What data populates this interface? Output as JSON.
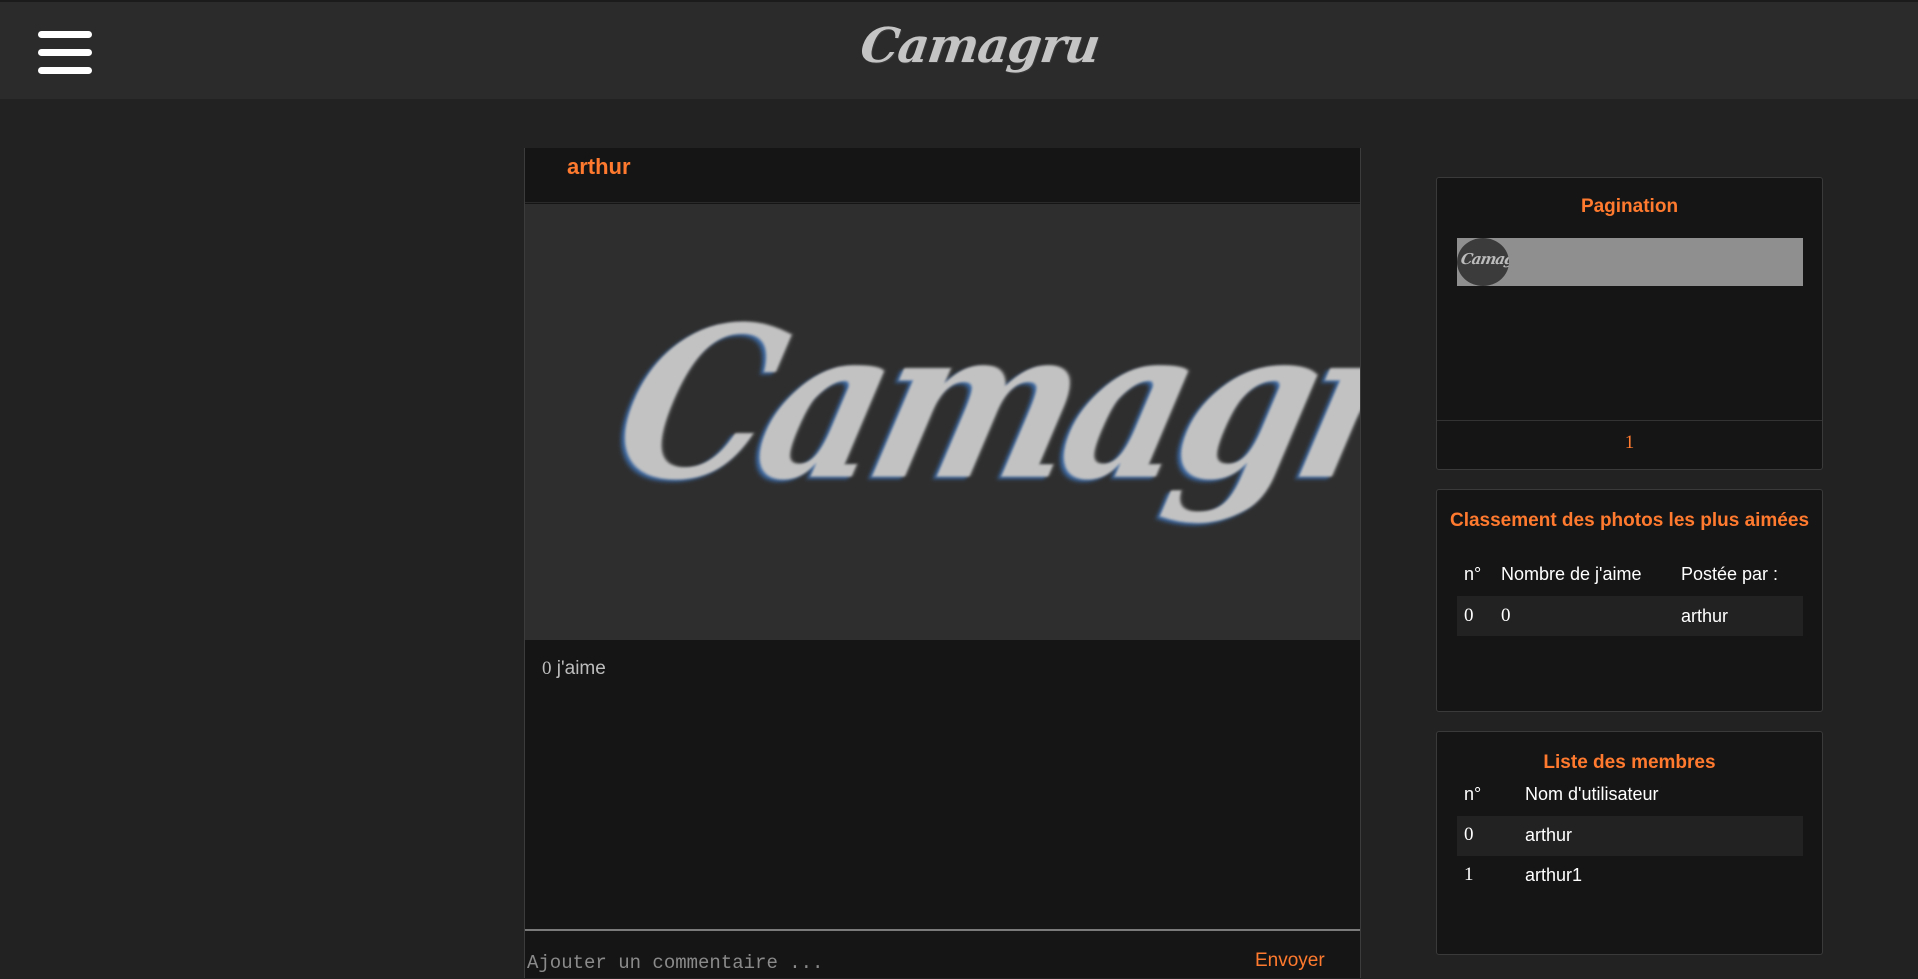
{
  "header": {
    "menu_icon": "hamburger-menu-icon",
    "brand": "Camagru"
  },
  "post": {
    "author": "arthur",
    "image_text": "Camagru",
    "likes_count": "0",
    "likes_label": "j'aime",
    "comment_placeholder": "Ajouter un commentaire ...",
    "send_label": "Envoyer"
  },
  "pagination": {
    "title": "Pagination",
    "thumb_text": "Camagru",
    "current_page": "1"
  },
  "ranking": {
    "title": "Classement des photos les plus aimées",
    "headers": [
      "n°",
      "Nombre de j'aime",
      "Postée par :"
    ],
    "rows": [
      {
        "n": "0",
        "likes": "0",
        "user": "arthur"
      }
    ]
  },
  "members": {
    "title": "Liste des membres",
    "headers": [
      "n°",
      "Nom d'utilisateur"
    ],
    "rows": [
      {
        "n": "0",
        "user": "arthur"
      },
      {
        "n": "1",
        "user": "arthur1"
      }
    ]
  },
  "colors": {
    "accent": "#ff7a2e",
    "background": "#222222",
    "header_bg": "#2b2b2b",
    "panel_bg": "#151515"
  }
}
